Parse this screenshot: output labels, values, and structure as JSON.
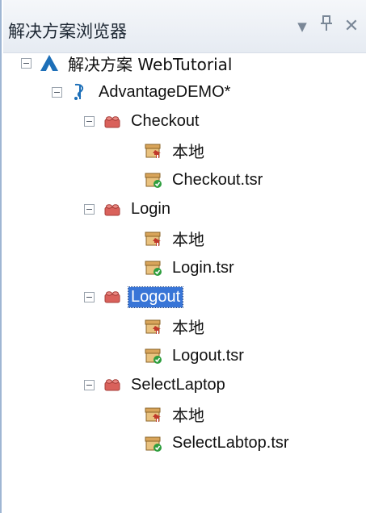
{
  "panel": {
    "title": "解决方案浏览器",
    "buttons": {
      "dropdown_glyph": "▼",
      "pin_glyph": "ᛘ",
      "close_glyph": "✕"
    }
  },
  "tree": {
    "solution": {
      "label": "解决方案 WebTutorial"
    },
    "project": {
      "label": "AdvantageDEMO*"
    },
    "actions": [
      {
        "label": "Checkout",
        "local": "本地",
        "script": "Checkout.tsr",
        "selected": false
      },
      {
        "label": "Login",
        "local": "本地",
        "script": "Login.tsr",
        "selected": false
      },
      {
        "label": "Logout",
        "local": "本地",
        "script": "Logout.tsr",
        "selected": true
      },
      {
        "label": "SelectLaptop",
        "local": "本地",
        "script": "SelectLabtop.tsr",
        "selected": false
      }
    ]
  },
  "colors": {
    "selection": "#3875d7",
    "brick": "#d9615b",
    "solution_icon": "#1d6fb8",
    "local_icon": "#c0392b",
    "script_icon_badge": "#2e9e3e"
  }
}
